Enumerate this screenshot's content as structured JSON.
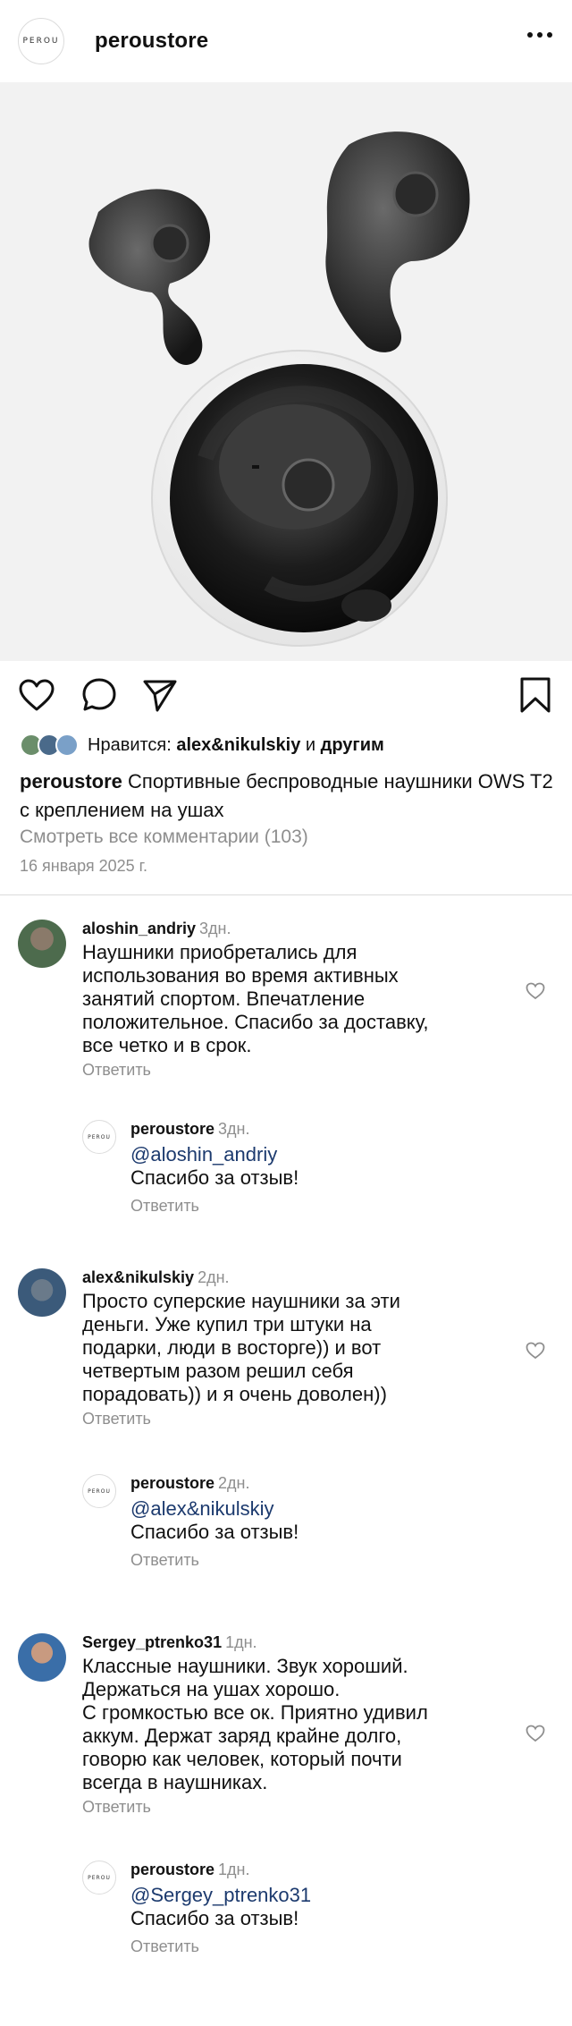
{
  "header": {
    "logo_text": "PEROU",
    "username": "peroustore"
  },
  "post": {
    "likes_prefix": "Нравится: ",
    "likes_user": "alex&nikulskiy",
    "likes_mid": " и ",
    "likes_suffix": "другим",
    "caption_user": "peroustore",
    "caption_text": " Спортивные беспроводные наушники OWS T2 с креплением на ушах",
    "view_comments": "Смотреть все комментарии (103)",
    "date": "16 января 2025 г."
  },
  "comments": [
    {
      "user": "aloshin_andriy",
      "time": "3дн.",
      "text": "Наушники приобретались для\nиспользования во время активных\nзанятий спортом. Впечатление\nположительное. Спасибо за доставку,\nвсе четко и в срок.",
      "reply_label": "Ответить",
      "reply": {
        "user": "peroustore",
        "time": "3дн.",
        "mention": "@aloshin_andriy",
        "text": "Спасибо за отзыв!",
        "reply_label": "Ответить"
      }
    },
    {
      "user": "alex&nikulskiy",
      "time": "2дн.",
      "text": "Просто суперские наушники за эти\nденьги. Уже купил три штуки на\nподарки, люди в восторге)) и вот\nчетвертым разом решил себя\nпорадовать)) и я очень доволен))",
      "reply_label": "Ответить",
      "reply": {
        "user": "peroustore",
        "time": "2дн.",
        "mention": "@alex&nikulskiy",
        "text": "Спасибо за отзыв!",
        "reply_label": "Ответить"
      }
    },
    {
      "user": "Sergey_ptrenko31",
      "time": "1дн.",
      "text": "Классные наушники. Звук хороший.\nДержаться на ушах хорошо.\nС громкостью все ок. Приятно удивил\nаккум. Держат заряд крайне долго,\nговорю как человек, который почти\nвсегда в наушниках.",
      "reply_label": "Ответить",
      "reply": {
        "user": "peroustore",
        "time": "1дн.",
        "mention": "@Sergey_ptrenko31",
        "text": "Спасибо за отзыв!",
        "reply_label": "Ответить"
      }
    }
  ],
  "colors": {
    "text": "#111111",
    "muted": "#8e8e8e",
    "mention": "#1c3a6e",
    "photo_bg": "#f2f2f2"
  }
}
